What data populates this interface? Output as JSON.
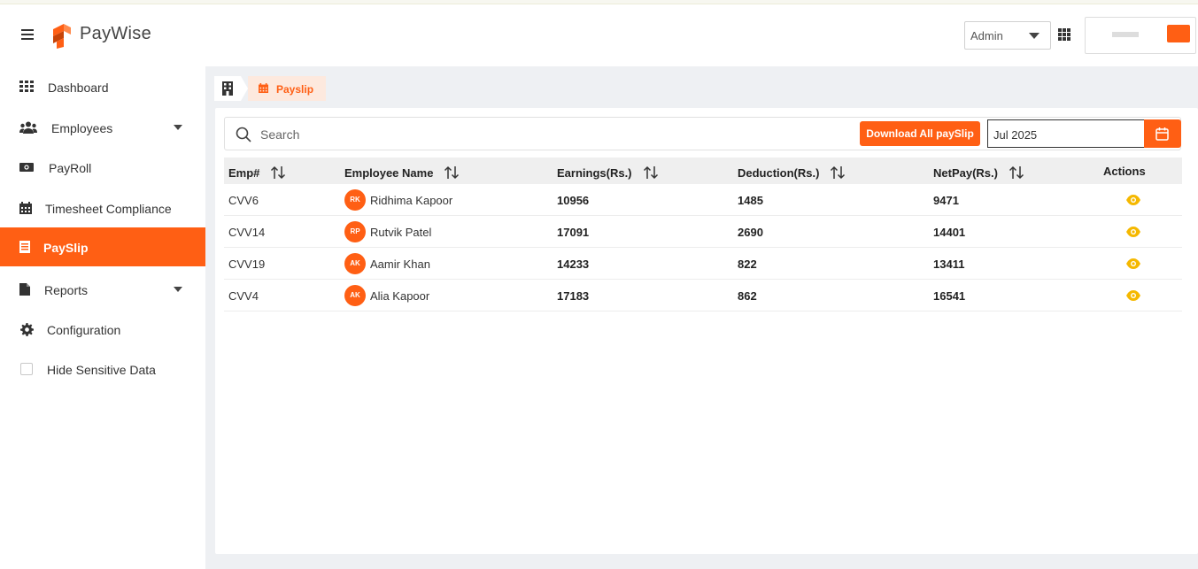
{
  "app": {
    "brand": "PayWise",
    "role": "Admin"
  },
  "sidebar": {
    "items": [
      {
        "label": "Dashboard"
      },
      {
        "label": "Employees"
      },
      {
        "label": "PayRoll"
      },
      {
        "label": "Timesheet Compliance"
      },
      {
        "label": "PaySlip"
      },
      {
        "label": "Reports"
      },
      {
        "label": "Configuration"
      },
      {
        "label": "Hide Sensitive Data"
      }
    ]
  },
  "breadcrumb": {
    "current": "Payslip"
  },
  "toolbar": {
    "search_placeholder": "Search",
    "download_label": "Download All paySlip",
    "period": "Jul 2025"
  },
  "table": {
    "columns": [
      "Emp#",
      "Employee Name",
      "Earnings(Rs.)",
      "Deduction(Rs.)",
      "NetPay(Rs.)",
      "Actions"
    ],
    "rows": [
      {
        "emp": "CVV6",
        "initials": "RK",
        "name": "Ridhima Kapoor",
        "earnings": "10956",
        "deduction": "1485",
        "netpay": "9471"
      },
      {
        "emp": "CVV14",
        "initials": "RP",
        "name": "Rutvik Patel",
        "earnings": "17091",
        "deduction": "2690",
        "netpay": "14401"
      },
      {
        "emp": "CVV19",
        "initials": "AK",
        "name": "Aamir Khan",
        "earnings": "14233",
        "deduction": "822",
        "netpay": "13411"
      },
      {
        "emp": "CVV4",
        "initials": "AK",
        "name": "Alia Kapoor",
        "earnings": "17183",
        "deduction": "862",
        "netpay": "16541"
      }
    ]
  },
  "colors": {
    "accent": "#ff5f14",
    "eye": "#f5b800"
  },
  "icons": [
    "hamburger-icon",
    "grid-icon",
    "users-icon",
    "money-icon",
    "calendar-icon",
    "document-icon",
    "gear-icon",
    "building-icon",
    "search-icon",
    "sort-icon",
    "eye-icon",
    "apps-icon"
  ]
}
